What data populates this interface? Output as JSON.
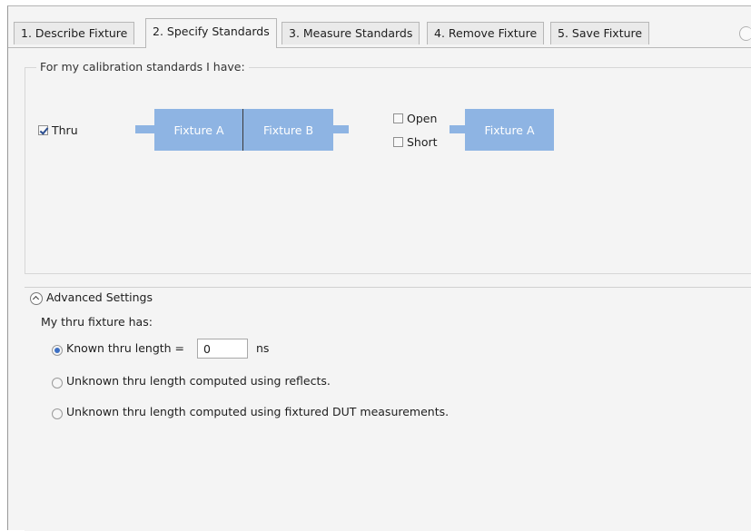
{
  "tabs": [
    {
      "label": "1. Describe Fixture",
      "active": false
    },
    {
      "label": "2. Specify Standards",
      "active": true
    },
    {
      "label": "3. Measure Standards",
      "active": false
    },
    {
      "label": "4. Remove Fixture",
      "active": false
    },
    {
      "label": "5. Save Fixture",
      "active": false
    }
  ],
  "standards": {
    "title": "For my calibration standards I have:",
    "thru": {
      "label": "Thru",
      "checked": true
    },
    "open": {
      "label": "Open",
      "checked": false
    },
    "short": {
      "label": "Short",
      "checked": false
    },
    "diagram": {
      "thru_left": "Fixture A",
      "thru_right": "Fixture B",
      "reflect": "Fixture A"
    }
  },
  "advanced": {
    "title": "Advanced Settings",
    "subtitle": "My thru fixture has:",
    "options": [
      {
        "label": "Known thru length =",
        "selected": true
      },
      {
        "label": "Unknown thru length computed using reflects.",
        "selected": false
      },
      {
        "label": "Unknown thru length computed using fixtured DUT measurements.",
        "selected": false
      }
    ],
    "length_value": "0",
    "length_unit": "ns"
  },
  "colors": {
    "fixture_fill": "#8eb4e3",
    "radio_selected": "#3d6fc3"
  }
}
